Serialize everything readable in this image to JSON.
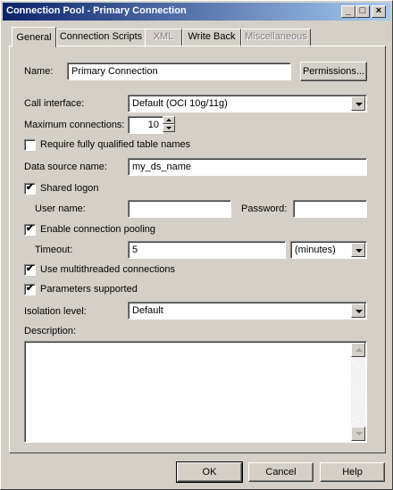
{
  "window": {
    "title": "Connection Pool - Primary Connection",
    "title_bar_color": "#0a246a"
  },
  "title_buttons": {
    "minimize": "_",
    "maximize": "□",
    "close": "×"
  },
  "tabs": [
    {
      "label": "General",
      "state": "active"
    },
    {
      "label": "Connection Scripts",
      "state": "enabled"
    },
    {
      "label": "XML",
      "state": "disabled"
    },
    {
      "label": "Write Back",
      "state": "enabled"
    },
    {
      "label": "Miscellaneous",
      "state": "disabled"
    }
  ],
  "form": {
    "name_label": "Name:",
    "name_value": "Primary Connection",
    "permissions_label": "Permissions...",
    "call_interface_label": "Call interface:",
    "call_interface_value": "Default (OCI 10g/11g)",
    "max_connections_label": "Maximum connections:",
    "max_connections_value": "10",
    "require_fq_label": "Require fully qualified table names",
    "require_fq_checked": false,
    "data_source_label": "Data source name:",
    "data_source_value": "my_ds_name",
    "shared_logon_label": "Shared logon",
    "shared_logon_checked": true,
    "user_name_label": "User name:",
    "user_name_value": "",
    "password_label": "Password:",
    "password_value": "",
    "enable_pooling_label": "Enable connection pooling",
    "enable_pooling_checked": true,
    "timeout_label": "Timeout:",
    "timeout_value": "5",
    "timeout_unit": "(minutes)",
    "multithreaded_label": "Use multithreaded connections",
    "multithreaded_checked": true,
    "parameters_label": "Parameters supported",
    "parameters_checked": true,
    "isolation_label": "Isolation level:",
    "isolation_value": "Default",
    "description_label": "Description:",
    "description_value": ""
  },
  "checkmark": "✔",
  "footer": {
    "ok_label": "OK",
    "cancel_label": "Cancel",
    "help_label": "Help"
  }
}
